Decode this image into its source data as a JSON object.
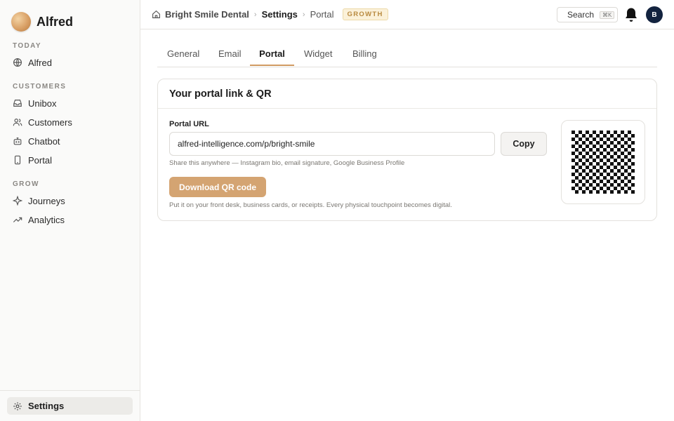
{
  "app": {
    "name": "Alfred"
  },
  "sidebar": {
    "sections": {
      "today": "TODAY",
      "customers": "CUSTOMERS",
      "grow": "GROW"
    },
    "items": {
      "alfred": "Alfred",
      "unibox": "Unibox",
      "customers": "Customers",
      "chatbot": "Chatbot",
      "portal": "Portal",
      "journeys": "Journeys",
      "analytics": "Analytics"
    },
    "settings": "Settings"
  },
  "header": {
    "breadcrumb": {
      "business": "Bright Smile Dental",
      "section": "Settings",
      "page": "Portal",
      "separator": "›"
    },
    "plan_badge": "GROWTH",
    "search_label": "Search",
    "search_shortcut": "⌘K",
    "avatar_initial": "B"
  },
  "tabs": [
    {
      "label": "General",
      "active": false
    },
    {
      "label": "Email",
      "active": false
    },
    {
      "label": "Portal",
      "active": true
    },
    {
      "label": "Widget",
      "active": false
    },
    {
      "label": "Billing",
      "active": false
    }
  ],
  "card": {
    "title": "Your portal link & QR",
    "url_label": "Portal URL",
    "url_value": "alfred-intelligence.com/p/bright-smile",
    "copy_label": "Copy",
    "url_hint": "Share this anywhere — Instagram bio, email signature, Google Business Profile",
    "download_label": "Download QR code",
    "download_hint": "Put it on your front desk, business cards, or receipts. Every physical touchpoint becomes digital."
  },
  "colors": {
    "accent": "#d4a472",
    "badge_text": "#b8893e",
    "avatar_bg": "#13233f"
  },
  "icons": {
    "brand": "alfred-orb-icon",
    "alfred": "globe-icon",
    "unibox": "inbox-icon",
    "customers": "users-icon",
    "chatbot": "bot-icon",
    "portal": "phone-icon",
    "journeys": "sparkle-icon",
    "analytics": "trend-icon",
    "settings": "gear-icon",
    "home": "home-icon",
    "notifications": "bell-icon",
    "qr": "qr-code-icon"
  }
}
